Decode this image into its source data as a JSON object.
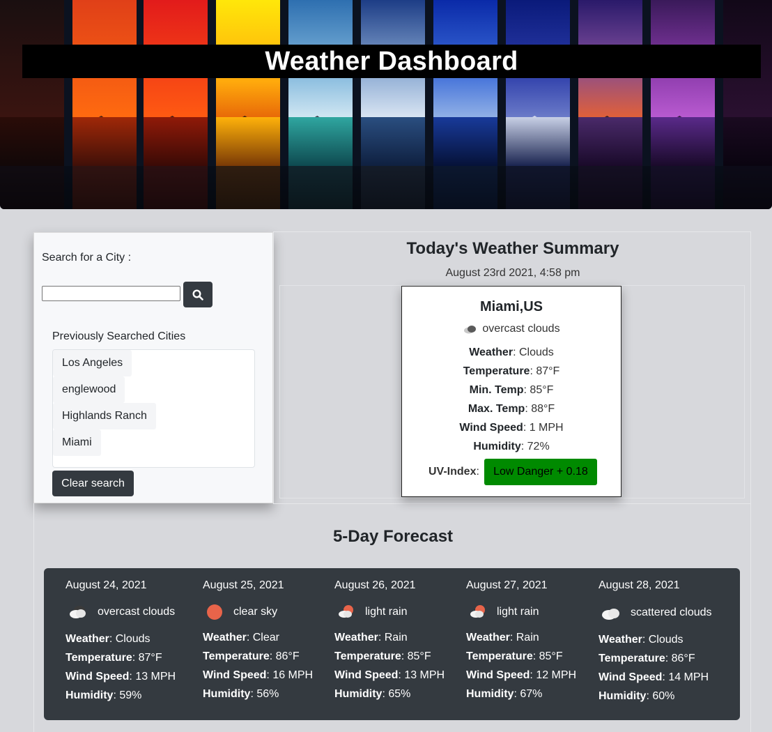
{
  "header": {
    "title": "Weather Dashboard"
  },
  "sidebar": {
    "search_label": "Search for a City :",
    "search_value": "",
    "search_button_icon": "search-icon",
    "previous_label": "Previously Searched Cities",
    "cities": [
      "Los Angeles",
      "englewood",
      "Highlands Ranch",
      "Miami"
    ],
    "clear_label": "Clear search"
  },
  "today": {
    "section_title": "Today's Weather Summary",
    "datetime": "August 23rd 2021, 4:58 pm",
    "city": "Miami,US",
    "icon": "overcast-clouds-icon",
    "description": "overcast clouds",
    "fields": [
      {
        "label": "Weather",
        "value": ": Clouds"
      },
      {
        "label": "Temperature",
        "value": ": 87°F"
      },
      {
        "label": "Min. Temp",
        "value": ": 85°F"
      },
      {
        "label": "Max. Temp",
        "value": ": 88°F"
      },
      {
        "label": "Wind Speed",
        "value": ": 1 MPH"
      },
      {
        "label": "Humidity",
        "value": ": 72%"
      }
    ],
    "uv_label": "UV-Index",
    "uv_sep": ":",
    "uv_value": "Low Danger + 0.18",
    "uv_color": "#008a00"
  },
  "forecast": {
    "section_title": "5-Day Forecast",
    "days": [
      {
        "date": "August 24, 2021",
        "icon": "overcast-clouds-icon",
        "description": "overcast clouds",
        "weather_label": "Weather",
        "weather": ": Clouds",
        "temp_label": "Temperature",
        "temp": ": 87°F",
        "wind_label": "Wind Speed",
        "wind": ": 13 MPH",
        "humidity_label": "Humidity",
        "humidity": ": 59%"
      },
      {
        "date": "August 25, 2021",
        "icon": "clear-sky-icon",
        "description": "clear sky",
        "weather_label": "Weather",
        "weather": ": Clear",
        "temp_label": "Temperature",
        "temp": ": 86°F",
        "wind_label": "Wind Speed",
        "wind": ": 16 MPH",
        "humidity_label": "Humidity",
        "humidity": ": 56%"
      },
      {
        "date": "August 26, 2021",
        "icon": "light-rain-icon",
        "description": "light rain",
        "weather_label": "Weather",
        "weather": ": Rain",
        "temp_label": "Temperature",
        "temp": ": 85°F",
        "wind_label": "Wind Speed",
        "wind": ": 13 MPH",
        "humidity_label": "Humidity",
        "humidity": ": 65%"
      },
      {
        "date": "August 27, 2021",
        "icon": "light-rain-icon",
        "description": "light rain",
        "weather_label": "Weather",
        "weather": ": Rain",
        "temp_label": "Temperature",
        "temp": ": 85°F",
        "wind_label": "Wind Speed",
        "wind": ": 12 MPH",
        "humidity_label": "Humidity",
        "humidity": ": 67%"
      },
      {
        "date": "August 28, 2021",
        "icon": "scattered-clouds-icon",
        "description": "scattered clouds",
        "weather_label": "Weather",
        "weather": ": Clouds",
        "temp_label": "Temperature",
        "temp": ": 86°F",
        "wind_label": "Wind Speed",
        "wind": ": 14 MPH",
        "humidity_label": "Humidity",
        "humidity": ": 60%"
      }
    ]
  },
  "colors": {
    "page_bg": "#d7d8dc",
    "dark": "#343a40",
    "uv_low": "#008a00",
    "sun": "#e8644a"
  }
}
